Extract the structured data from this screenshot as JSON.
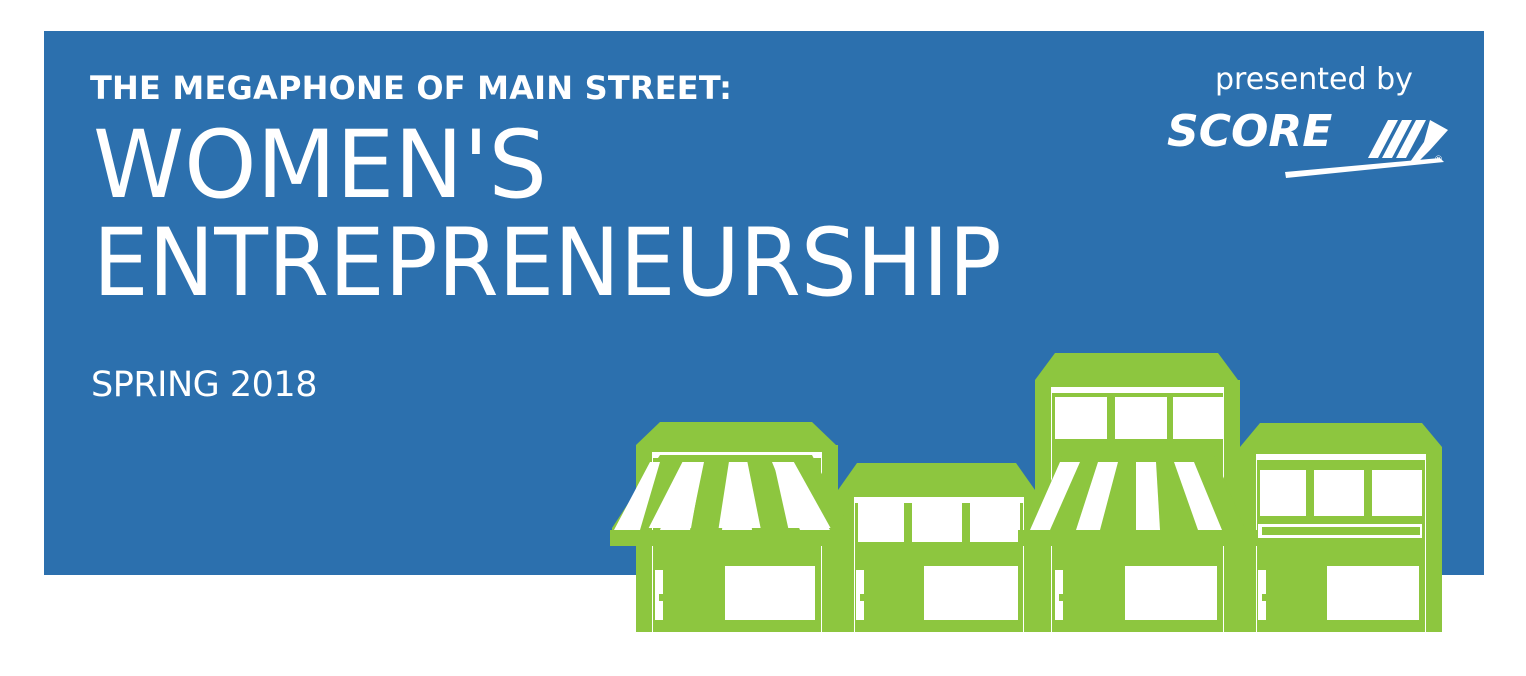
{
  "header": {
    "kicker": "THE MEGAPHONE OF MAIN STREET:",
    "title_line1": "WOMEN'S",
    "title_line2": "ENTREPRENEURSHIP",
    "season": "SPRING 2018"
  },
  "sponsor": {
    "presented_by": "presented by",
    "brand": "SCORE"
  },
  "colors": {
    "banner": "#2c70ae",
    "text": "#ffffff",
    "building": "#8dc63f"
  },
  "illustration": {
    "icon": "storefronts-illustration",
    "buildings": [
      "awning-shop",
      "shop-with-windows",
      "tall-awning-shop",
      "shop-with-sign"
    ]
  }
}
